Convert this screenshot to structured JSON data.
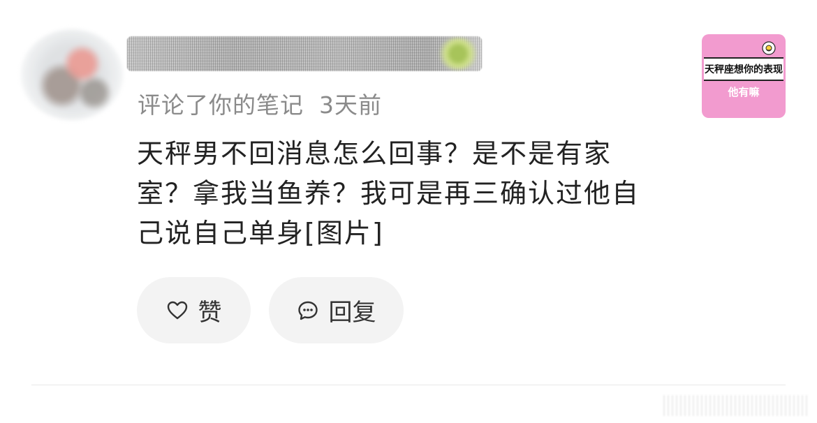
{
  "comment": {
    "meta_action": "评论了你的笔记",
    "time": "3天前",
    "text": "天秤男不回消息怎么回事？是不是有家室？拿我当鱼养？我可是再三确认过他自己说自己单身[图片]"
  },
  "thumbnail": {
    "title": "天秤座想你的表现",
    "subtitle": "他有嘛",
    "bg_color": "#f29bcf"
  },
  "actions": {
    "like_label": "赞",
    "like_icon": "heart-icon",
    "reply_label": "回复",
    "reply_icon": "chat-bubble-icon"
  }
}
